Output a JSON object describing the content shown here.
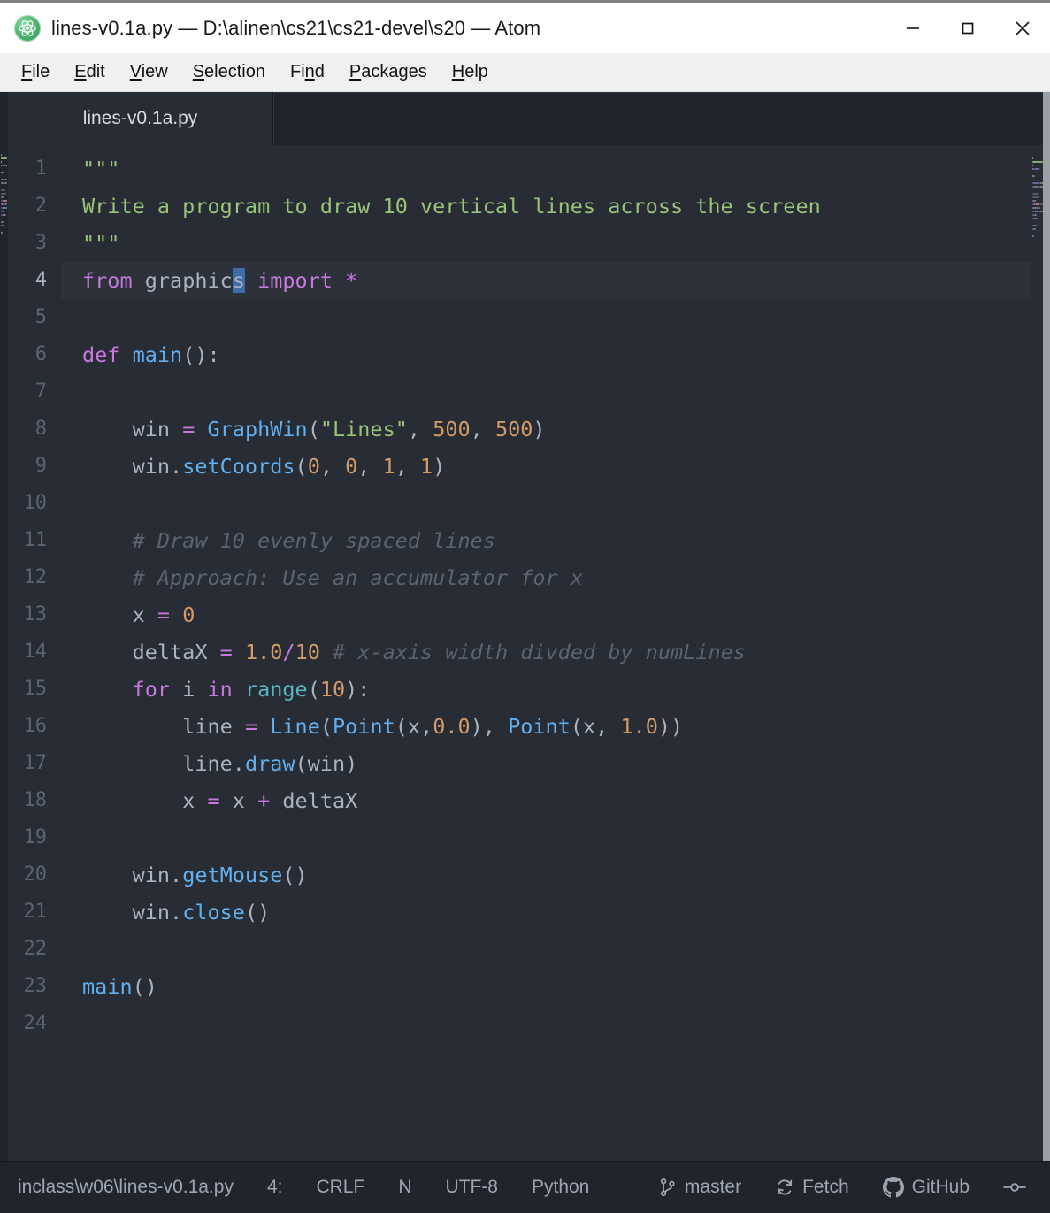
{
  "window": {
    "title": "lines-v0.1a.py — D:\\alinen\\cs21\\cs21-devel\\s20 — Atom",
    "controls": {
      "minimize": "minimize-button",
      "maximize": "maximize-button",
      "close": "close-button"
    },
    "logo_name": "atom-logo"
  },
  "menubar": {
    "items": [
      {
        "label": "File",
        "mnemonic_index": 0
      },
      {
        "label": "Edit",
        "mnemonic_index": 0
      },
      {
        "label": "View",
        "mnemonic_index": 0
      },
      {
        "label": "Selection",
        "mnemonic_index": 0
      },
      {
        "label": "Find",
        "mnemonic_index": 2
      },
      {
        "label": "Packages",
        "mnemonic_index": 0
      },
      {
        "label": "Help",
        "mnemonic_index": 0
      }
    ]
  },
  "tabs": [
    {
      "label": "lines-v0.1a.py",
      "active": true
    }
  ],
  "editor": {
    "language": "Python",
    "active_line": 4,
    "cursor_column": 15,
    "lines": [
      {
        "n": 1,
        "tokens": [
          {
            "t": "\"\"\"",
            "c": "s-str"
          }
        ]
      },
      {
        "n": 2,
        "tokens": [
          {
            "t": "Write a program to draw 10 vertical lines across the screen",
            "c": "s-str"
          }
        ]
      },
      {
        "n": 3,
        "tokens": [
          {
            "t": "\"\"\"",
            "c": "s-str"
          }
        ]
      },
      {
        "n": 4,
        "tokens": [
          {
            "t": "from ",
            "c": "s-kw"
          },
          {
            "t": "graphic",
            "c": "s-plain"
          },
          {
            "t": "s",
            "c": "cursor-sel"
          },
          {
            "t": " ",
            "c": "s-plain"
          },
          {
            "t": "import",
            "c": "s-kw"
          },
          {
            "t": " ",
            "c": "s-plain"
          },
          {
            "t": "*",
            "c": "s-op"
          }
        ]
      },
      {
        "n": 5,
        "tokens": []
      },
      {
        "n": 6,
        "tokens": [
          {
            "t": "def ",
            "c": "s-kw"
          },
          {
            "t": "main",
            "c": "s-fn"
          },
          {
            "t": "():",
            "c": "s-plain"
          }
        ]
      },
      {
        "n": 7,
        "tokens": []
      },
      {
        "n": 8,
        "tokens": [
          {
            "t": "    win ",
            "c": "s-plain"
          },
          {
            "t": "=",
            "c": "s-op"
          },
          {
            "t": " ",
            "c": "s-plain"
          },
          {
            "t": "GraphWin",
            "c": "s-fn"
          },
          {
            "t": "(",
            "c": "s-plain"
          },
          {
            "t": "\"Lines\"",
            "c": "s-str"
          },
          {
            "t": ", ",
            "c": "s-plain"
          },
          {
            "t": "500",
            "c": "s-num"
          },
          {
            "t": ", ",
            "c": "s-plain"
          },
          {
            "t": "500",
            "c": "s-num"
          },
          {
            "t": ")",
            "c": "s-plain"
          }
        ]
      },
      {
        "n": 9,
        "tokens": [
          {
            "t": "    win.",
            "c": "s-plain"
          },
          {
            "t": "setCoords",
            "c": "s-fn"
          },
          {
            "t": "(",
            "c": "s-plain"
          },
          {
            "t": "0",
            "c": "s-num"
          },
          {
            "t": ", ",
            "c": "s-plain"
          },
          {
            "t": "0",
            "c": "s-num"
          },
          {
            "t": ", ",
            "c": "s-plain"
          },
          {
            "t": "1",
            "c": "s-num"
          },
          {
            "t": ", ",
            "c": "s-plain"
          },
          {
            "t": "1",
            "c": "s-num"
          },
          {
            "t": ")",
            "c": "s-plain"
          }
        ]
      },
      {
        "n": 10,
        "tokens": []
      },
      {
        "n": 11,
        "tokens": [
          {
            "t": "    # Draw 10 evenly spaced lines",
            "c": "s-cmt"
          }
        ]
      },
      {
        "n": 12,
        "tokens": [
          {
            "t": "    # Approach: Use an accumulator for x",
            "c": "s-cmt"
          }
        ]
      },
      {
        "n": 13,
        "tokens": [
          {
            "t": "    x ",
            "c": "s-plain"
          },
          {
            "t": "=",
            "c": "s-op"
          },
          {
            "t": " ",
            "c": "s-plain"
          },
          {
            "t": "0",
            "c": "s-num"
          }
        ]
      },
      {
        "n": 14,
        "tokens": [
          {
            "t": "    deltaX ",
            "c": "s-plain"
          },
          {
            "t": "=",
            "c": "s-op"
          },
          {
            "t": " ",
            "c": "s-plain"
          },
          {
            "t": "1.0",
            "c": "s-num"
          },
          {
            "t": "/",
            "c": "s-op"
          },
          {
            "t": "10",
            "c": "s-num"
          },
          {
            "t": " ",
            "c": "s-plain"
          },
          {
            "t": "# x-axis width divded by numLines",
            "c": "s-cmt"
          }
        ]
      },
      {
        "n": 15,
        "tokens": [
          {
            "t": "    ",
            "c": "s-plain"
          },
          {
            "t": "for",
            "c": "s-kw"
          },
          {
            "t": " i ",
            "c": "s-plain"
          },
          {
            "t": "in",
            "c": "s-kw"
          },
          {
            "t": " ",
            "c": "s-plain"
          },
          {
            "t": "range",
            "c": "s-builtin"
          },
          {
            "t": "(",
            "c": "s-plain"
          },
          {
            "t": "10",
            "c": "s-num"
          },
          {
            "t": "):",
            "c": "s-plain"
          }
        ]
      },
      {
        "n": 16,
        "tokens": [
          {
            "t": "        line ",
            "c": "s-plain"
          },
          {
            "t": "=",
            "c": "s-op"
          },
          {
            "t": " ",
            "c": "s-plain"
          },
          {
            "t": "Line",
            "c": "s-fn"
          },
          {
            "t": "(",
            "c": "s-plain"
          },
          {
            "t": "Point",
            "c": "s-fn"
          },
          {
            "t": "(x,",
            "c": "s-plain"
          },
          {
            "t": "0.0",
            "c": "s-num"
          },
          {
            "t": "), ",
            "c": "s-plain"
          },
          {
            "t": "Point",
            "c": "s-fn"
          },
          {
            "t": "(x, ",
            "c": "s-plain"
          },
          {
            "t": "1.0",
            "c": "s-num"
          },
          {
            "t": "))",
            "c": "s-plain"
          }
        ]
      },
      {
        "n": 17,
        "tokens": [
          {
            "t": "        line.",
            "c": "s-plain"
          },
          {
            "t": "draw",
            "c": "s-fn"
          },
          {
            "t": "(win)",
            "c": "s-plain"
          }
        ]
      },
      {
        "n": 18,
        "tokens": [
          {
            "t": "        x ",
            "c": "s-plain"
          },
          {
            "t": "=",
            "c": "s-op"
          },
          {
            "t": " x ",
            "c": "s-plain"
          },
          {
            "t": "+",
            "c": "s-op"
          },
          {
            "t": " deltaX",
            "c": "s-plain"
          }
        ]
      },
      {
        "n": 19,
        "tokens": []
      },
      {
        "n": 20,
        "tokens": [
          {
            "t": "    win.",
            "c": "s-plain"
          },
          {
            "t": "getMouse",
            "c": "s-fn"
          },
          {
            "t": "()",
            "c": "s-plain"
          }
        ]
      },
      {
        "n": 21,
        "tokens": [
          {
            "t": "    win.",
            "c": "s-plain"
          },
          {
            "t": "close",
            "c": "s-fn"
          },
          {
            "t": "()",
            "c": "s-plain"
          }
        ]
      },
      {
        "n": 22,
        "tokens": []
      },
      {
        "n": 23,
        "tokens": [
          {
            "t": "main",
            "c": "s-fn"
          },
          {
            "t": "()",
            "c": "s-plain"
          }
        ]
      },
      {
        "n": 24,
        "tokens": []
      }
    ]
  },
  "statusbar": {
    "file_path": "inclass\\w06\\lines-v0.1a.py",
    "cursor_position": "4:",
    "line_ending": "CRLF",
    "whitespace_indicator": "N",
    "encoding": "UTF-8",
    "grammar": "Python",
    "branch": "master",
    "fetch": "Fetch",
    "github": "GitHub"
  },
  "theme": {
    "editor_bg": "#282c34",
    "chrome_bg": "#21252b",
    "active_line_bg": "#2c313a",
    "text": "#abb2bf",
    "line_number": "#5c6370",
    "string": "#98c379",
    "keyword": "#c678dd",
    "function": "#61afef",
    "number": "#d19a66",
    "comment": "#5c6370",
    "builtin": "#56b6c2",
    "cursor": "#3e6ca8",
    "titlebar_bg": "#ffffff",
    "menubar_bg": "#f0f0f0",
    "accent_green": "#4caf6d"
  }
}
